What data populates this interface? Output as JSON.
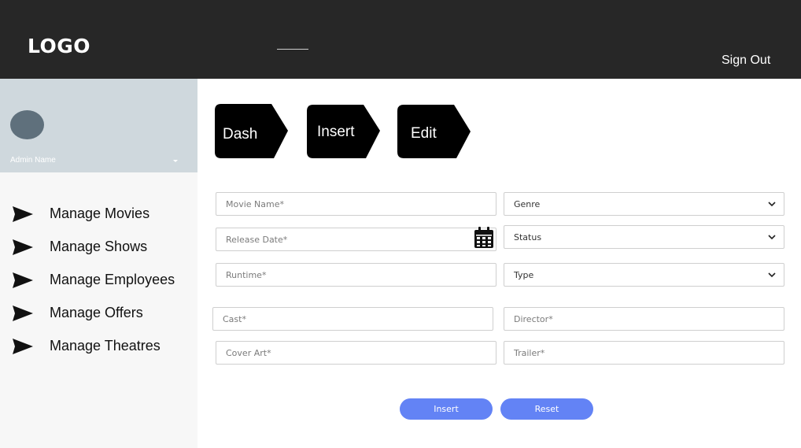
{
  "header": {
    "logo": "LOGO",
    "sign_out": "Sign Out"
  },
  "sidebar": {
    "admin_name": "Admin Name",
    "items": [
      {
        "label": "Manage Movies",
        "icon": "send-arrow-icon"
      },
      {
        "label": "Manage Shows",
        "icon": "send-arrow-icon"
      },
      {
        "label": "Manage Employees",
        "icon": "send-arrow-icon"
      },
      {
        "label": "Manage Offers",
        "icon": "send-arrow-icon"
      },
      {
        "label": "Manage Theatres",
        "icon": "send-arrow-icon"
      }
    ]
  },
  "breadcrumbs": [
    "Dash",
    "Insert",
    "Edit"
  ],
  "form": {
    "movie_name": {
      "placeholder": "Movie Name*"
    },
    "release_date": {
      "placeholder": "Release Date*"
    },
    "runtime": {
      "placeholder": "Runtime*"
    },
    "cast": {
      "placeholder": "Cast*"
    },
    "cover_art": {
      "placeholder": "Cover Art*"
    },
    "genre": {
      "value": "Genre"
    },
    "status": {
      "value": "Status"
    },
    "type": {
      "value": "Type"
    },
    "director": {
      "placeholder": "Director*"
    },
    "trailer": {
      "placeholder": "Trailer*"
    }
  },
  "actions": {
    "insert": "Insert",
    "reset": "Reset"
  },
  "colors": {
    "header_bg": "#272727",
    "profile_bg": "#cfd8dd",
    "sidebar_bg": "#f7f7f7",
    "button": "#6383f5",
    "avatar": "#5f707c"
  }
}
